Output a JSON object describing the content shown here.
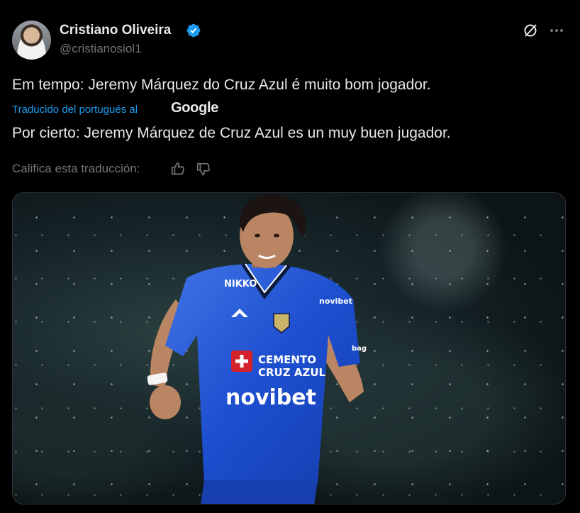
{
  "author": {
    "name": "Cristiano Oliveira",
    "handle": "@cristianosiol1"
  },
  "post": {
    "original_text": "Em tempo: Jeremy Márquez do Cruz Azul é muito bom jogador.",
    "translated_by_label": "Traducido del portugués al",
    "translation_provider": "Google",
    "translated_text": "Por cierto: Jeremy Márquez de Cruz Azul es un muy buen jugador.",
    "rate_translation_label": "Califica esta traducción:"
  },
  "media": {
    "jersey_sponsor_main": "novibet",
    "jersey_sponsor_badge_line1": "CEMENTO",
    "jersey_sponsor_badge_line2": "CRUZ AZUL",
    "jersey_shoulder_brand": "NIKKO",
    "jersey_chest_right": "novibet",
    "jersey_sleeve_text": "bag"
  },
  "icons": {
    "verified": "verified-badge-icon",
    "grok": "grok-icon",
    "more": "more-options-icon",
    "thumb_up": "thumb-up-icon",
    "thumb_down": "thumb-down-icon"
  },
  "colors": {
    "background": "#000000",
    "text_primary": "#e7e9ea",
    "text_secondary": "#71767b",
    "link": "#1d9bf0",
    "verified": "#1d9bf0",
    "jersey_blue": "#1d4fd0"
  }
}
